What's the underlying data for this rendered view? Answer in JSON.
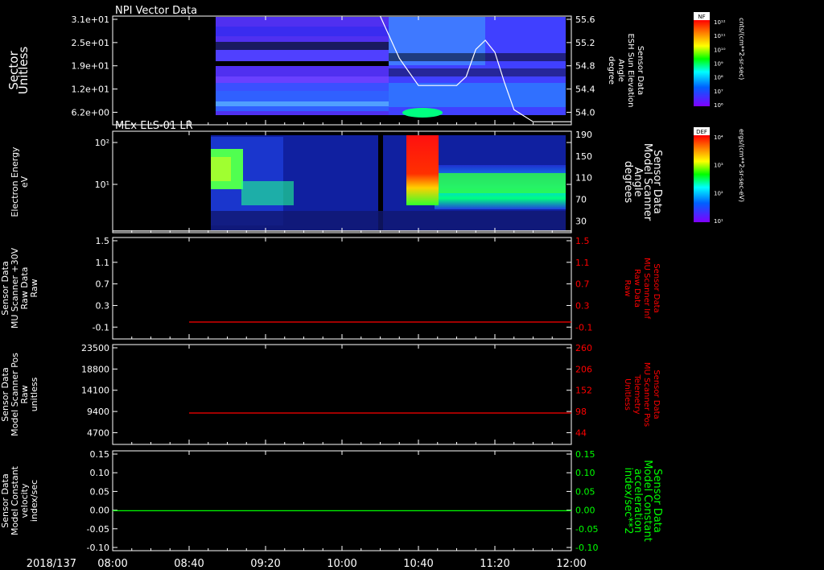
{
  "date_label": "2018/137",
  "time_ticks": [
    "08:00",
    "08:40",
    "09:20",
    "10:00",
    "10:40",
    "11:20",
    "12:00"
  ],
  "colors": {
    "white": "#ffffff",
    "red": "#ff0000",
    "green": "#00ff00"
  },
  "colorbars": [
    {
      "tag": "NF",
      "unit": "cnts/(cm**2-sr-sec)",
      "ticks": [
        "10¹²",
        "10¹¹",
        "10¹⁰",
        "10⁹",
        "10⁸",
        "10⁷",
        "10⁶"
      ]
    },
    {
      "tag": "DEF",
      "unit": "ergs/(cm**2-sr-sec-eV)",
      "ticks": [
        "10⁴",
        "10³",
        "10²",
        "10¹"
      ]
    }
  ],
  "panels": [
    {
      "title": "NPI Vector Data",
      "left_label": [
        "Sector",
        "Unitless"
      ],
      "left_ticks": [
        "3.1e+01",
        "2.5e+01",
        "1.9e+01",
        "1.2e+01",
        "6.2e+00"
      ],
      "right_label": [
        "Sensor Data",
        "ESH Sun Elevation",
        "Angle",
        "degree"
      ],
      "right_ticks": [
        "55.6",
        "55.2",
        "54.8",
        "54.4",
        "54.0"
      ]
    },
    {
      "title": "MEx ELS-01 LR",
      "left_label": [
        "Electron Energy",
        "eV"
      ],
      "left_ticks": [
        "10²",
        "10¹"
      ],
      "right_label": [
        "Sensor Data",
        "Model Scanner",
        "Angle",
        "degrees"
      ],
      "right_ticks": [
        "190",
        "150",
        "110",
        "70",
        "30"
      ]
    },
    {
      "title": "",
      "left_label": [
        "Sensor Data",
        "MU Scanner +30V",
        "Raw Data",
        "Raw"
      ],
      "left_ticks": [
        "1.5",
        "1.1",
        "0.7",
        "0.3",
        "-0.1"
      ],
      "right_label": [
        "Sensor Data",
        "MU Scanner Inf",
        "Raw Data",
        "Raw"
      ],
      "right_ticks": [
        "1.5",
        "1.1",
        "0.7",
        "0.3",
        "-0.1"
      ]
    },
    {
      "title": "",
      "left_label": [
        "Sensor Data",
        "Model Scanner Pos",
        "Raw",
        "unitless"
      ],
      "left_ticks": [
        "23500",
        "18800",
        "14100",
        "9400",
        "4700"
      ],
      "right_label": [
        "Sensor Data",
        "MU Scanner Pos",
        "Telemetry",
        "Unitless"
      ],
      "right_ticks": [
        "260",
        "206",
        "152",
        "98",
        "44"
      ]
    },
    {
      "title": "",
      "left_label": [
        "Sensor Data",
        "Model Constant",
        "velocity",
        "index/sec"
      ],
      "left_ticks": [
        "0.15",
        "0.10",
        "0.05",
        "0.00",
        "-0.05",
        "-0.10"
      ],
      "right_label": [
        "Sensor Data",
        "Model Constant",
        "acceleration",
        "index/sec**2"
      ],
      "right_ticks": [
        "0.15",
        "0.10",
        "0.05",
        "0.00",
        "-0.05",
        "-0.10"
      ]
    }
  ],
  "chart_data": [
    {
      "type": "heatmap",
      "title": "NPI Vector Data",
      "ylabel": "Sector Unitless",
      "ylim": [
        0,
        31
      ],
      "x_range": [
        "08:00",
        "12:00"
      ],
      "data_start": "08:50",
      "overlay": {
        "type": "line",
        "ylim": [
          53.8,
          55.6
        ],
        "x": [
          "10:20",
          "10:30",
          "10:40",
          "10:50",
          "11:00",
          "11:05",
          "11:10",
          "11:15",
          "11:20",
          "11:25",
          "11:30",
          "11:40",
          "12:00"
        ],
        "values": [
          55.6,
          54.9,
          54.45,
          54.45,
          54.45,
          54.6,
          55.05,
          55.2,
          55.0,
          54.5,
          54.05,
          53.85,
          53.85
        ]
      }
    },
    {
      "type": "heatmap",
      "title": "MEx ELS-01 LR",
      "ylabel": "Electron Energy eV",
      "yscale": "log",
      "x_range": [
        "08:00",
        "12:00"
      ],
      "data_start": "08:45",
      "overlay": {
        "type": "line",
        "ylim": [
          10,
          190
        ],
        "x": [
          "08:00",
          "12:00"
        ],
        "values": [
          13,
          13
        ]
      }
    },
    {
      "type": "line",
      "ylim": [
        -0.3,
        1.5
      ],
      "x": [
        "08:40",
        "12:00"
      ],
      "values": [
        0.0,
        0.0
      ]
    },
    {
      "type": "line",
      "ylim": [
        0,
        23500
      ],
      "x": [
        "08:40",
        "12:00"
      ],
      "values": [
        7400,
        7400
      ]
    },
    {
      "type": "line",
      "ylim": [
        -0.1,
        0.15
      ],
      "x": [
        "08:00",
        "12:00"
      ],
      "values": [
        0.0,
        0.0
      ]
    }
  ]
}
